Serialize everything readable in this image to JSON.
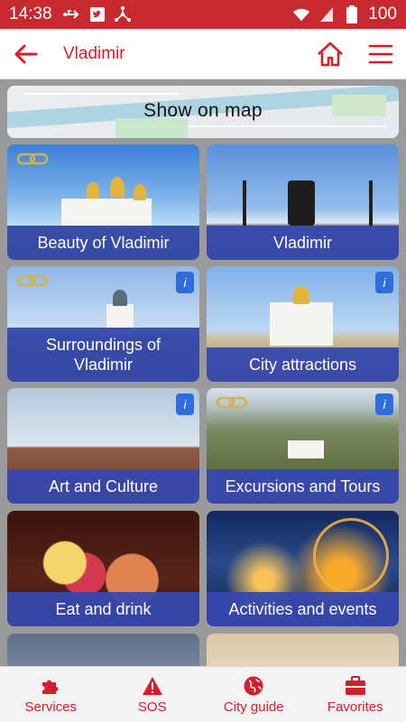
{
  "status_bar": {
    "time": "14:38",
    "battery": "100",
    "icons_left": [
      "usb-icon",
      "twitter-icon",
      "share-icon"
    ],
    "icons_right": [
      "wifi-icon",
      "signal-icon",
      "battery-icon"
    ]
  },
  "app_bar": {
    "title": "Vladimir",
    "accent": "#d1202b",
    "icons": [
      "back-arrow-icon",
      "home-icon",
      "menu-icon"
    ]
  },
  "map_banner": {
    "label": "Show on map"
  },
  "tiles": [
    {
      "label": "Beauty of Vladimir",
      "link_icon": true,
      "info": false
    },
    {
      "label": "Vladimir",
      "link_icon": false,
      "info": false
    },
    {
      "label": "Surroundings of Vladimir",
      "link_icon": true,
      "info": true
    },
    {
      "label": "City attractions",
      "link_icon": false,
      "info": true
    },
    {
      "label": "Art and Culture",
      "link_icon": false,
      "info": true
    },
    {
      "label": "Excursions and Tours",
      "link_icon": true,
      "info": true
    },
    {
      "label": "Eat and drink",
      "link_icon": false,
      "info": false
    },
    {
      "label": "Activities and events",
      "link_icon": false,
      "info": false
    }
  ],
  "info_badge_text": "i",
  "caption_color": "#3748ad",
  "bottom_nav": [
    {
      "label": "Services",
      "icon": "puzzle-icon"
    },
    {
      "label": "SOS",
      "icon": "warning-icon"
    },
    {
      "label": "City guide",
      "icon": "globe-icon"
    },
    {
      "label": "Favorites",
      "icon": "briefcase-icon"
    }
  ]
}
